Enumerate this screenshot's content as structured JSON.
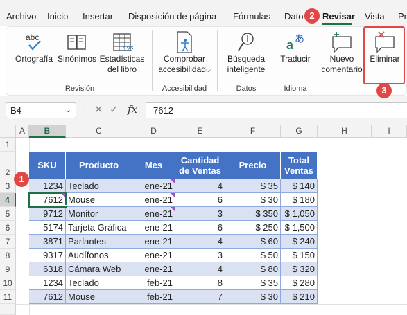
{
  "menu": {
    "tabs": [
      "Archivo",
      "Inicio",
      "Insertar",
      "Disposición de página",
      "Fórmulas",
      "Datos",
      "Revisar",
      "Vista",
      "Pr"
    ],
    "active_tab": "Revisar"
  },
  "ribbon": {
    "buttons": {
      "ortografia": "Ortografía",
      "abc": "abc",
      "sinonimos": "Sinónimos",
      "estadisticas_1": "Estadísticas",
      "estadisticas_2": "del libro",
      "comprobar_1": "Comprobar",
      "comprobar_2": "accesibilidad",
      "busqueda_1": "Búsqueda",
      "busqueda_2": "inteligente",
      "traducir": "Traducir",
      "nuevo_1": "Nuevo",
      "nuevo_2": "comentario",
      "eliminar": "Eliminar"
    },
    "groups": {
      "revision": "Revisión",
      "accesibilidad": "Accesibilidad",
      "datos": "Datos",
      "idioma": "Idioma"
    }
  },
  "formula_bar": {
    "name_box": "B4",
    "value": "7612",
    "fx": "fx"
  },
  "sheet": {
    "columns": [
      "A",
      "B",
      "C",
      "D",
      "E",
      "F",
      "G",
      "H",
      "I"
    ],
    "rows": [
      "1",
      "2",
      "3",
      "4",
      "5",
      "6",
      "7",
      "8",
      "9",
      "10",
      "11"
    ],
    "headers": {
      "sku": "SKU",
      "producto": "Producto",
      "mes": "Mes",
      "cantidad_1": "Cantidad",
      "cantidad_2": "de Ventas",
      "precio": "Precio",
      "total_1": "Total",
      "total_2": "Ventas"
    },
    "data": [
      {
        "sku": "1234",
        "producto": "Teclado",
        "mes": "ene-21",
        "cantidad": "4",
        "precio": "$ 35",
        "total": "$ 140"
      },
      {
        "sku": "7612",
        "producto": "Mouse",
        "mes": "ene-21",
        "cantidad": "6",
        "precio": "$ 30",
        "total": "$ 180"
      },
      {
        "sku": "9712",
        "producto": "Monitor",
        "mes": "ene-21",
        "cantidad": "3",
        "precio": "$ 350",
        "total": "$ 1,050"
      },
      {
        "sku": "5174",
        "producto": "Tarjeta Gráfica",
        "mes": "ene-21",
        "cantidad": "6",
        "precio": "$ 250",
        "total": "$ 1,500"
      },
      {
        "sku": "3871",
        "producto": "Parlantes",
        "mes": "ene-21",
        "cantidad": "4",
        "precio": "$ 60",
        "total": "$ 240"
      },
      {
        "sku": "9317",
        "producto": "Audífonos",
        "mes": "ene-21",
        "cantidad": "3",
        "precio": "$ 50",
        "total": "$ 150"
      },
      {
        "sku": "6318",
        "producto": "Cámara Web",
        "mes": "ene-21",
        "cantidad": "4",
        "precio": "$ 80",
        "total": "$ 320"
      },
      {
        "sku": "1234",
        "producto": "Teclado",
        "mes": "feb-21",
        "cantidad": "8",
        "precio": "$ 35",
        "total": "$ 280"
      },
      {
        "sku": "7612",
        "producto": "Mouse",
        "mes": "feb-21",
        "cantidad": "7",
        "precio": "$ 30",
        "total": "$ 210"
      }
    ]
  },
  "annotations": {
    "badge1": "1",
    "badge2": "2",
    "badge3": "3"
  },
  "colors": {
    "header_fill": "#4472c4",
    "band_fill": "#d9e1f2",
    "accent": "#1e7145",
    "annotation": "#e04848"
  }
}
